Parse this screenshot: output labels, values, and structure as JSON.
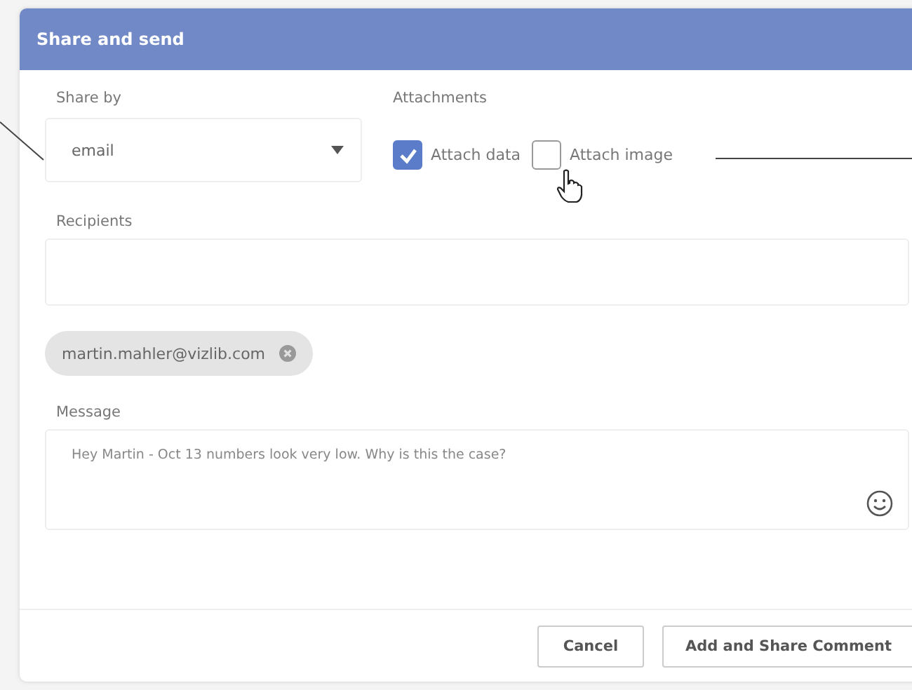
{
  "dialog": {
    "title": "Share and send"
  },
  "share_by": {
    "label": "Share by",
    "value": "email"
  },
  "attachments": {
    "label": "Attachments",
    "options": [
      {
        "label": "Attach data",
        "checked": true
      },
      {
        "label": "Attach image",
        "checked": false
      }
    ]
  },
  "recipients": {
    "label": "Recipients",
    "chips": [
      "martin.mahler@vizlib.com"
    ]
  },
  "message": {
    "label": "Message",
    "value": "Hey Martin - Oct 13 numbers look very low. Why is this the case?"
  },
  "buttons": [
    {
      "label": "Cancel",
      "kind": "secondary"
    },
    {
      "label": "Add and Share Comment",
      "kind": "primary"
    }
  ]
}
